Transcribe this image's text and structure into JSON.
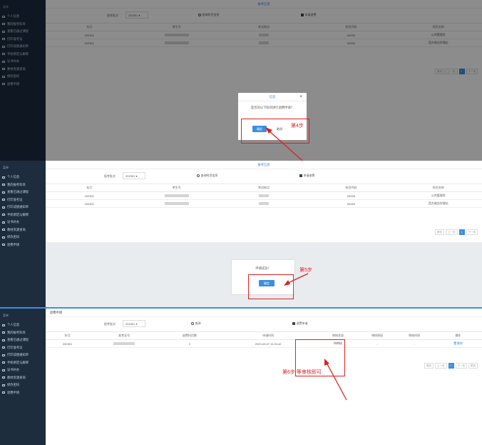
{
  "sidebar": {
    "header": "菜单",
    "items": [
      "个人信息",
      "我的报考科目",
      "查看已通过课程",
      "打印准考证",
      "打印成绩通知单",
      "手机绑定与解绑",
      "证书补办",
      "教材资源查询",
      "修改密码",
      "退费申请"
    ]
  },
  "step4": {
    "page_title": "报考信息",
    "term_label": "报考批次",
    "term_value": "202301",
    "search_btn": "查询科目信息",
    "apply_btn": "申请退费",
    "columns": [
      "年月",
      "考生号",
      "考试地点",
      "科目代码",
      "科目名称"
    ],
    "rows": [
      [
        "202301",
        "",
        "",
        "03035",
        "公共管理学"
      ],
      [
        "202301",
        "",
        "",
        "00260",
        "西方政治学理论"
      ]
    ],
    "pager": [
      "首页",
      "上一页",
      "1",
      "下一页"
    ],
    "dialog_title": "信息",
    "dialog_close": "×",
    "dialog_msg": "是否对以下科目进行退费申请？",
    "confirm": "确定",
    "cancel": "取消",
    "annotation": "第4步"
  },
  "step5": {
    "page_title": "报考信息",
    "term_label": "报考批次",
    "term_value": "202301",
    "search_btn": "查询科目信息",
    "apply_btn": "申请退费",
    "columns": [
      "年月",
      "考生号",
      "考试地点",
      "科目代码",
      "科目名称"
    ],
    "rows": [
      [
        "202301",
        "",
        "",
        "03035",
        "公共管理学"
      ],
      [
        "202301",
        "",
        "",
        "00260",
        "西方政治学理论"
      ]
    ],
    "pager": [
      "首页",
      "上一页",
      "1",
      "下一页"
    ],
    "dialog_msg": "申请成功！",
    "confirm": "确定",
    "annotation": "第5步"
  },
  "step6": {
    "tab_label": "退费申请",
    "term_label": "报考批次",
    "term_value": "202301",
    "search_btn": "查询",
    "apply_btn": "退费申请",
    "columns": [
      "年月",
      "准考证号",
      "退费科目数",
      "申请时间",
      "审核状态",
      "审核原因",
      "审核时间",
      "操作"
    ],
    "row": [
      "202301",
      "",
      "2",
      "2023-03-07 11:24:42",
      "待审核",
      "-",
      "-",
      "删除"
    ],
    "pager": [
      "首页",
      "上一页",
      "1",
      "下一页",
      "尾页"
    ],
    "annotation": "第6步 等审核即可"
  },
  "colors": {
    "sidebar": "#1d2d3e",
    "accent": "#3b8fe0",
    "annotation": "#e02020"
  },
  "icons": [
    "search-icon",
    "document-icon",
    "menu-item-icon",
    "delete-icon"
  ]
}
